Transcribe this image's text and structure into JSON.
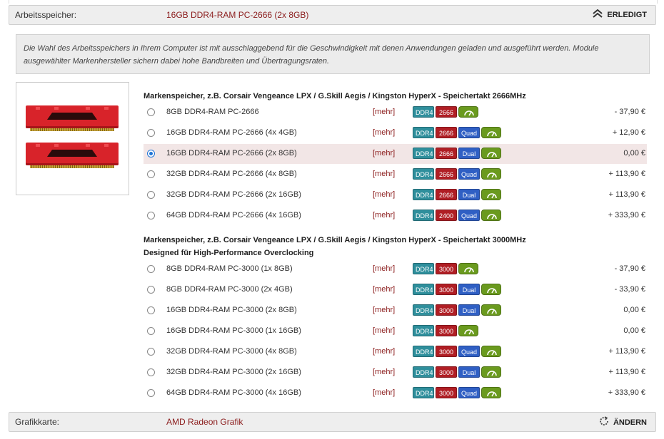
{
  "memory_section": {
    "label": "Arbeitsspeicher:",
    "selected_value": "16GB DDR4-RAM PC-2666 (2x 8GB)",
    "action_label": "ERLEDIGT",
    "action_icon": "double-chevron-up-icon"
  },
  "info_text": "Die Wahl des Arbeitsspeichers in Ihrem Computer ist mit ausschlaggebend für die Geschwindigkeit mit denen Anwendungen geladen und ausgeführt werden. Module ausgewählter Markenhersteller sichern dabei hohe Bandbreiten und Übertragungsraten.",
  "colors": {
    "accent_red": "#8b1c1c",
    "badge_ddr": "#2f8f9c",
    "badge_speed": "#b01e24",
    "badge_channel": "#2f5fc4",
    "badge_perf": "#6a9a1e",
    "selected_row": "#f2e6e6"
  },
  "groups": [
    {
      "title_line1": "Markenspeicher, z.B. Corsair Vengeance LPX / G.Skill Aegis / Kingston HyperX - Speichertakt 2666MHz",
      "title_line2": "",
      "options": [
        {
          "label": "8GB DDR4-RAM PC-2666",
          "more": "[mehr]",
          "ddr": "DDR4",
          "speed": "2666",
          "channel": "",
          "price": "- 37,90 €",
          "selected": false
        },
        {
          "label": "16GB DDR4-RAM PC-2666 (4x 4GB)",
          "more": "[mehr]",
          "ddr": "DDR4",
          "speed": "2666",
          "channel": "Quad",
          "price": "+ 12,90 €",
          "selected": false
        },
        {
          "label": "16GB DDR4-RAM PC-2666 (2x 8GB)",
          "more": "[mehr]",
          "ddr": "DDR4",
          "speed": "2666",
          "channel": "Dual",
          "price": "0,00 €",
          "selected": true
        },
        {
          "label": "32GB DDR4-RAM PC-2666 (4x 8GB)",
          "more": "[mehr]",
          "ddr": "DDR4",
          "speed": "2666",
          "channel": "Quad",
          "price": "+ 113,90 €",
          "selected": false
        },
        {
          "label": "32GB DDR4-RAM PC-2666 (2x 16GB)",
          "more": "[mehr]",
          "ddr": "DDR4",
          "speed": "2666",
          "channel": "Dual",
          "price": "+ 113,90 €",
          "selected": false
        },
        {
          "label": "64GB DDR4-RAM PC-2666 (4x 16GB)",
          "more": "[mehr]",
          "ddr": "DDR4",
          "speed": "2400",
          "channel": "Quad",
          "price": "+ 333,90 €",
          "selected": false
        }
      ]
    },
    {
      "title_line1": "Markenspeicher, z.B. Corsair Vengeance LPX / G.Skill Aegis / Kingston HyperX - Speichertakt 3000MHz",
      "title_line2": "Designed für High-Performance Overclocking",
      "options": [
        {
          "label": "8GB DDR4-RAM PC-3000 (1x 8GB)",
          "more": "[mehr]",
          "ddr": "DDR4",
          "speed": "3000",
          "channel": "",
          "price": "- 37,90 €",
          "selected": false
        },
        {
          "label": "8GB DDR4-RAM PC-3000 (2x 4GB)",
          "more": "[mehr]",
          "ddr": "DDR4",
          "speed": "3000",
          "channel": "Dual",
          "price": "- 33,90 €",
          "selected": false
        },
        {
          "label": "16GB DDR4-RAM PC-3000 (2x 8GB)",
          "more": "[mehr]",
          "ddr": "DDR4",
          "speed": "3000",
          "channel": "Dual",
          "price": "0,00 €",
          "selected": false
        },
        {
          "label": "16GB DDR4-RAM PC-3000 (1x 16GB)",
          "more": "[mehr]",
          "ddr": "DDR4",
          "speed": "3000",
          "channel": "",
          "price": "0,00 €",
          "selected": false
        },
        {
          "label": "32GB DDR4-RAM PC-3000 (4x 8GB)",
          "more": "[mehr]",
          "ddr": "DDR4",
          "speed": "3000",
          "channel": "Quad",
          "price": "+ 113,90 €",
          "selected": false
        },
        {
          "label": "32GB DDR4-RAM PC-3000 (2x 16GB)",
          "more": "[mehr]",
          "ddr": "DDR4",
          "speed": "3000",
          "channel": "Dual",
          "price": "+ 113,90 €",
          "selected": false
        },
        {
          "label": "64GB DDR4-RAM PC-3000 (4x 16GB)",
          "more": "[mehr]",
          "ddr": "DDR4",
          "speed": "3000",
          "channel": "Quad",
          "price": "+ 333,90 €",
          "selected": false
        }
      ]
    }
  ],
  "graphics_section": {
    "label": "Grafikkarte:",
    "selected_value": "AMD Radeon Grafik",
    "action_label": "ÄNDERN",
    "action_icon": "refresh-icon"
  }
}
